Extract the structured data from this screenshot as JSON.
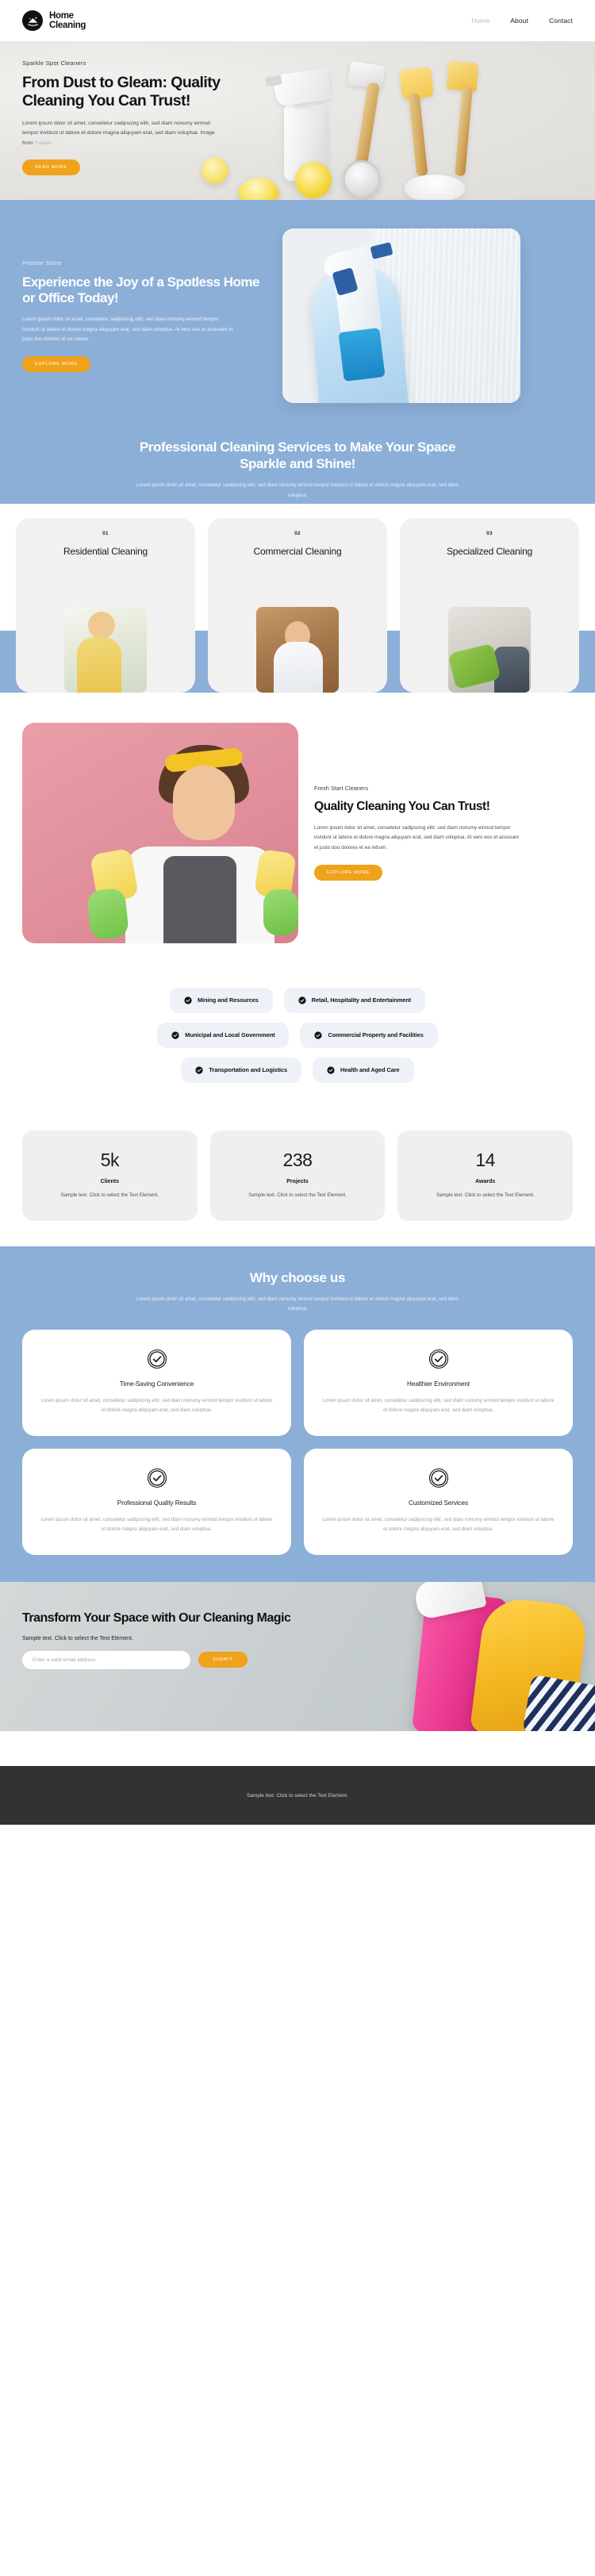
{
  "header": {
    "brand_line1": "Home",
    "brand_line2": "Cleaning",
    "logo_icon": "house-sparkle-icon",
    "nav": [
      {
        "label": "Home",
        "active": true
      },
      {
        "label": "About",
        "active": false
      },
      {
        "label": "Contact",
        "active": false
      }
    ]
  },
  "hero": {
    "eyebrow": "Sparkle Spot Cleaners",
    "title": "From Dust to Gleam: Quality Cleaning You Can Trust!",
    "body": "Lorem ipsum dolor sit amet, consetetur sadipscing elitr, sed diam nonumy eirmod tempor invidunt ut labore et dolore magna aliquyam erat, sed diam voluptua. Image from ",
    "credit_link": "Freepik",
    "button": "READ MORE"
  },
  "blue_hero": {
    "eyebrow": "Pristine Shine",
    "title": "Experience the Joy of a Spotless Home or Office Today!",
    "body": "Lorem ipsum dolor sit amet, consetetur sadipscing elitr, sed diam nonumy eirmod tempor invidunt ut labore et dolore magna aliquyam erat, sed diam voluptua. At vero eos et accusam et justo duo dolores et ea rebum.",
    "button": "EXPLORE MORE"
  },
  "services": {
    "title": "Professional Cleaning Services to Make Your Space Sparkle and Shine!",
    "body": "Lorem ipsum dolor sit amet, consetetur sadipscing elitr, sed diam nonumy eirmod tempor invidunt ut labore et dolore magna aliquyam erat, sed diam voluptua.",
    "cards": [
      {
        "number": "01",
        "name": "Residential Cleaning"
      },
      {
        "number": "02",
        "name": "Commercial Cleaning"
      },
      {
        "number": "03",
        "name": "Specialized Cleaning"
      }
    ]
  },
  "quality": {
    "eyebrow": "Fresh Start Cleaners",
    "title": "Quality Cleaning You Can Trust!",
    "body": "Lorem ipsum dolor sit amet, consetetur sadipscing elitr, sed diam nonumy eirmod tempor invidunt ut labore et dolore magna aliquyam erat, sed diam voluptua. At vero eos et accusam et justo duo dolores et ea rebum.",
    "button": "EXPLORE MORE"
  },
  "industries": {
    "icon": "check-circle-icon",
    "rows": [
      [
        "Mining and Resources",
        "Retail, Hospitality and Entertainment"
      ],
      [
        "Municipal and Local Government",
        "Commercial Property and Facilities"
      ],
      [
        "Transportation and Logistics",
        "Health and Aged Care"
      ]
    ]
  },
  "stats": [
    {
      "number": "5k",
      "label": "Clients",
      "sub": "Sample text. Click to select the Text Element."
    },
    {
      "number": "238",
      "label": "Projects",
      "sub": "Sample text. Click to select the Text Element."
    },
    {
      "number": "14",
      "label": "Awards",
      "sub": "Sample text. Click to select the Text Element."
    }
  ],
  "why": {
    "title": "Why choose us",
    "sub": "Lorem ipsum dolor sit amet, consetetur sadipscing elitr, sed diam nonumy eirmod tempor invidunt ut labore et dolore magna aliquyam erat, sed diam voluptua.",
    "icon": "check-circle-icon",
    "cards": [
      {
        "name": "Time-Saving Convenience",
        "body": "Lorem ipsum dolor sit amet, consetetur sadipscing elitr, sed diam nonumy eirmod tempor invidunt ut labore et dolore magna aliquyam erat, sed diam voluptua."
      },
      {
        "name": "Healthier Environment",
        "body": "Lorem ipsum dolor sit amet, consetetur sadipscing elitr, sed diam nonumy eirmod tempor invidunt ut labore et dolore magna aliquyam erat, sed diam voluptua."
      },
      {
        "name": "Professional Quality Results",
        "body": "Lorem ipsum dolor sit amet, consetetur sadipscing elitr, sed diam nonumy eirmod tempor invidunt ut labore et dolore magna aliquyam erat, sed diam voluptua."
      },
      {
        "name": "Customized Services",
        "body": "Lorem ipsum dolor sit amet, consetetur sadipscing elitr, sed diam nonumy eirmod tempor invidunt ut labore et dolore magna aliquyam erat, sed diam voluptua."
      }
    ]
  },
  "cta": {
    "title": "Transform Your Space with Our Cleaning Magic",
    "sub": "Sample text. Click to select the Text Element.",
    "email_placeholder": "Enter a valid email address",
    "email_value": "",
    "button": "SUBMIT"
  },
  "footer": {
    "text": "Sample text. Click to select the Text Element."
  },
  "colors": {
    "accent_orange": "#f0a21b",
    "section_blue": "#8cafd8",
    "footer_dark": "#323232",
    "card_gray": "#efefef",
    "pill_gray": "#eef1f7"
  }
}
